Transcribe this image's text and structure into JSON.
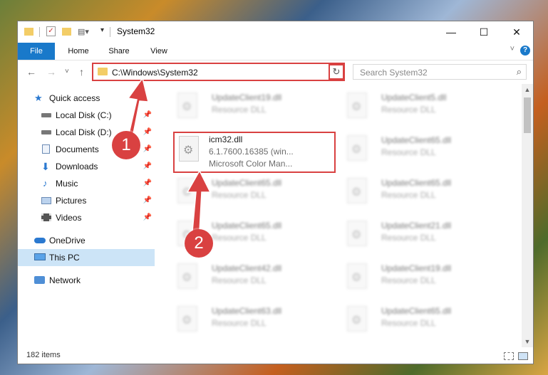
{
  "window": {
    "title": "System32",
    "minimize": "—",
    "maximize": "☐",
    "close": "✕"
  },
  "ribbon": {
    "tabs": [
      "File",
      "Home",
      "Share",
      "View"
    ],
    "help": "?",
    "collapse": "˅"
  },
  "nav": {
    "back": "←",
    "forward": "→",
    "recent": "˅",
    "up": "↑"
  },
  "address": {
    "path": "C:\\Windows\\System32",
    "dropdown": "˅",
    "refresh": "↻"
  },
  "search": {
    "placeholder": "Search System32",
    "icon": "⌕"
  },
  "sidebar": {
    "items": [
      {
        "label": "Quick access",
        "icon": "star-icon",
        "pinned": false
      },
      {
        "label": "Local Disk (C:)",
        "icon": "drive-icon",
        "pinned": true
      },
      {
        "label": "Local Disk (D:)",
        "icon": "drive-icon",
        "pinned": true
      },
      {
        "label": "Documents",
        "icon": "documents-icon",
        "pinned": true
      },
      {
        "label": "Downloads",
        "icon": "download-icon",
        "pinned": true
      },
      {
        "label": "Music",
        "icon": "music-icon",
        "pinned": true
      },
      {
        "label": "Pictures",
        "icon": "pictures-icon",
        "pinned": true
      },
      {
        "label": "Videos",
        "icon": "videos-icon",
        "pinned": true
      },
      {
        "label": "OneDrive",
        "icon": "cloud-icon",
        "pinned": false
      },
      {
        "label": "This PC",
        "icon": "computer-icon",
        "pinned": false,
        "selected": true
      },
      {
        "label": "Network",
        "icon": "network-icon",
        "pinned": false
      }
    ]
  },
  "files": {
    "highlighted": {
      "name": "icm32.dll",
      "version": "6.1.7600.16385 (win...",
      "description": "Microsoft Color Man..."
    },
    "left_column": [
      {
        "name": "UpdateClient19.dll",
        "type": "Resource DLL"
      },
      {
        "name": "UpdateClient65.dll",
        "type": "Resource DLL"
      },
      {
        "name": "UpdateClient65.dll",
        "type": "Resource DLL"
      },
      {
        "name": "UpdateClient42.dll",
        "type": "Resource DLL"
      },
      {
        "name": "UpdateClient63.dll",
        "type": "Resource DLL"
      }
    ],
    "right_column": [
      {
        "name": "UpdateClient5.dll",
        "type": "Resource DLL"
      },
      {
        "name": "UpdateClient65.dll",
        "type": "Resource DLL"
      },
      {
        "name": "UpdateClient65.dll",
        "type": "Resource DLL"
      },
      {
        "name": "UpdateClient21.dll",
        "type": "Resource DLL"
      },
      {
        "name": "UpdateClient19.dll",
        "type": "Resource DLL"
      },
      {
        "name": "UpdateClient65.dll",
        "type": "Resource DLL"
      }
    ]
  },
  "status": {
    "count": "182 items"
  },
  "annotations": {
    "step1": "1",
    "step2": "2",
    "color": "#d94141"
  },
  "colors": {
    "accent": "#1979ca",
    "selection": "#cce4f7",
    "highlight": "#d94141"
  }
}
